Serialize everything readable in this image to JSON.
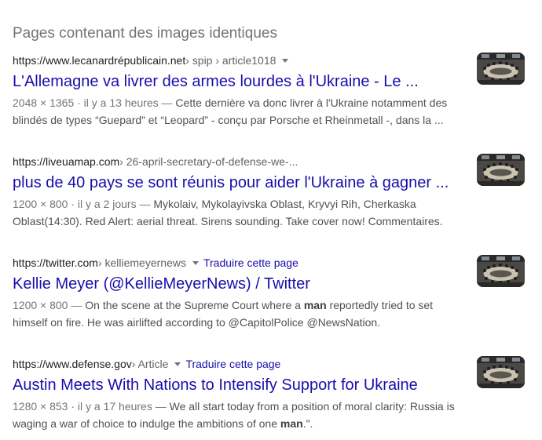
{
  "heading": "Pages contenant des images identiques",
  "results": [
    {
      "domain": "https://www.lecanardrépublicain.net",
      "path": " › spip › article1018",
      "title": "L'Allemagne va livrer des armes lourdes à l'Ukraine - Le ...",
      "meta": "2048 × 1365 · il y a 13 heures — ",
      "snippet_a": "Cette dernière va donc livrer à l'Ukraine notamment des blindés de types “Guepard” et “Leopard” - conçu par Porsche et Rheinmetall -, dans la ...",
      "thumb_icon": "conference-room-thumbnail-icon"
    },
    {
      "domain": "https://liveuamap.com",
      "path": " › 26-april-secretary-of-defense-we-...",
      "title": "plus de 40 pays se sont réunis pour aider l'Ukraine à gagner ...",
      "meta": "1200 × 800 · il y a 2 jours — ",
      "snippet_a": "Mykolaiv, Mykolayivska Oblast, Kryvyi Rih, Cherkaska Oblast(14:30). Red Alert: aerial threat. Sirens sounding. Take cover now! Commentaires.",
      "thumb_icon": "conference-room-thumbnail-icon"
    },
    {
      "domain": "https://twitter.com",
      "path": " › kelliemeyernews",
      "translate": "Traduire cette page",
      "title": "Kellie Meyer (@KellieMeyerNews) / Twitter",
      "meta": "1200 × 800 — ",
      "snippet_a": "On the scene at the Supreme Court where a ",
      "snippet_bold": "man",
      "snippet_b": " reportedly tried to set himself on fire. He was airlifted according to @CapitolPolice @NewsNation.",
      "thumb_icon": "conference-room-thumbnail-icon"
    },
    {
      "domain": "https://www.defense.gov",
      "path": " › Article",
      "translate": "Traduire cette page",
      "title": "Austin Meets With Nations to Intensify Support for Ukraine",
      "meta": "1280 × 853 · il y a 17 heures — ",
      "snippet_a": "We all start today from a position of moral clarity: Russia is waging a war of choice to indulge the ambitions of one ",
      "snippet_bold": "man",
      "snippet_b": ".\".",
      "thumb_icon": "conference-room-thumbnail-icon"
    }
  ],
  "colors": {
    "link": "#1a0dab",
    "heading": "#70757a",
    "snippet": "#4d5156"
  }
}
